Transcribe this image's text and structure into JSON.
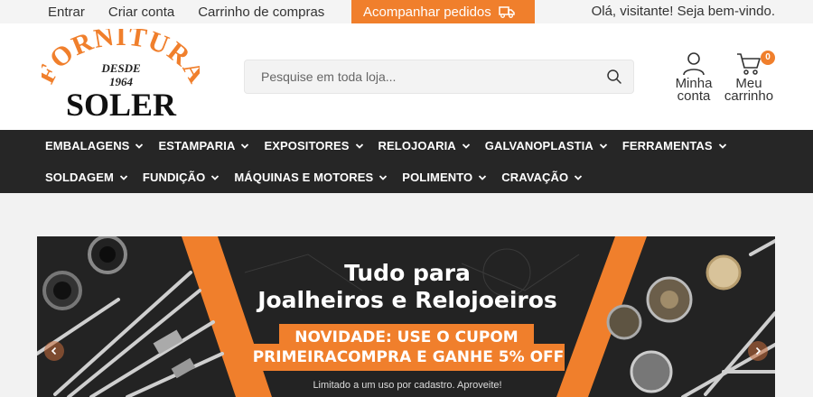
{
  "topbar": {
    "links": [
      "Entrar",
      "Criar conta",
      "Carrinho de compras"
    ],
    "track_label": "Acompanhar pedidos",
    "welcome": "Olá, visitante! Seja bem-vindo."
  },
  "logo": {
    "arc_text": "FORNITURA",
    "since": "DESDE",
    "year": "1964",
    "name": "SOLER"
  },
  "search": {
    "placeholder": "Pesquise em toda loja..."
  },
  "account": {
    "line1": "Minha",
    "line2": "conta"
  },
  "cart": {
    "line1": "Meu",
    "line2": "carrinho",
    "count": "0"
  },
  "nav": {
    "row1": [
      "EMBALAGENS",
      "ESTAMPARIA",
      "EXPOSITORES",
      "RELOJOARIA",
      "GALVANOPLASTIA",
      "FERRAMENTAS"
    ],
    "row2": [
      "SOLDAGEM",
      "FUNDIÇÃO",
      "MÁQUINAS E MOTORES",
      "POLIMENTO",
      "CRAVAÇÃO"
    ]
  },
  "banner": {
    "title_line1": "Tudo para",
    "title_line2": "Joalheiros e Relojoeiros",
    "coupon_line1": "NOVIDADE: USE O CUPOM",
    "coupon_line2": "PRIMEIRACOMPRA E GANHE 5% OFF",
    "note": "Limitado a um uso por cadastro. Aproveite!"
  },
  "colors": {
    "accent": "#f07f2c",
    "nav_bg": "#262626"
  }
}
